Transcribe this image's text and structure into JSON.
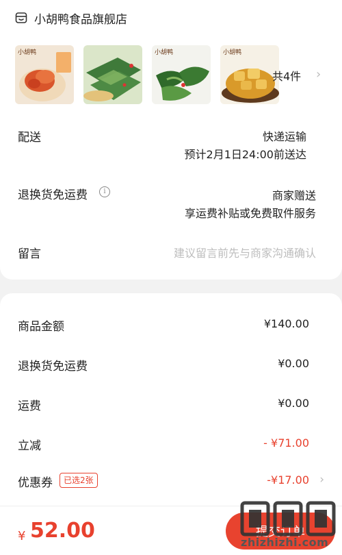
{
  "store": {
    "name": "小胡鸭食品旗舰店",
    "icon": "store-icon"
  },
  "products": {
    "thumbnails": [
      {
        "brand_mark": "小胡鸭",
        "colors": [
          "#f2e6d6",
          "#d9552b",
          "#f3b06a"
        ]
      },
      {
        "brand_mark": "",
        "colors": [
          "#dbe6c9",
          "#3f7a3a",
          "#8fbf6a"
        ]
      },
      {
        "brand_mark": "小胡鸭",
        "colors": [
          "#f3f3ee",
          "#2f6a2a",
          "#86b860"
        ]
      },
      {
        "brand_mark": "小胡鸭",
        "colors": [
          "#f6f1e6",
          "#d99a2a",
          "#f0c45a"
        ]
      }
    ],
    "count_label": "共4件"
  },
  "delivery": {
    "label": "配送",
    "method": "快递运输",
    "eta": "预计2月1日24:00前送达"
  },
  "return_shipping": {
    "label": "退换货免运费",
    "value": "商家赠送",
    "desc": "享运费补贴或免费取件服务"
  },
  "message": {
    "label": "留言",
    "placeholder": "建议留言前先与商家沟通确认"
  },
  "summary": {
    "goods_amount_label": "商品金额",
    "goods_amount": "¥140.00",
    "return_fee_label": "退换货免运费",
    "return_fee": "¥0.00",
    "shipping_label": "运费",
    "shipping": "¥0.00",
    "discount_label": "立减",
    "discount": "- ¥71.00",
    "coupon_label": "优惠券",
    "coupon_tag": "已选2张",
    "coupon": "-¥17.00"
  },
  "footer": {
    "currency": "¥",
    "total": "52.00",
    "submit_label": "提交订单"
  },
  "watermark": {
    "text": "zhizhizhi.com",
    "logo": "值值值"
  },
  "colors": {
    "accent": "#e8412e",
    "background": "#f2f2f2",
    "placeholder": "#bdbdbd"
  }
}
